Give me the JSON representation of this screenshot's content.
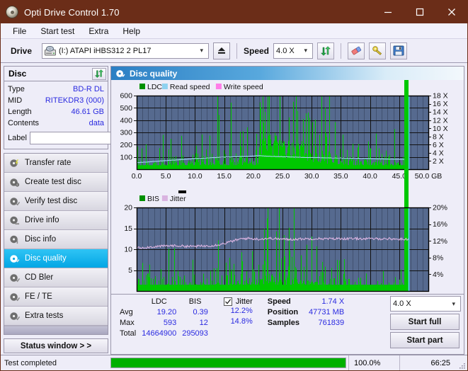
{
  "window": {
    "title": "Opti Drive Control 1.70",
    "icon": "disc-icon",
    "minimize": "minimize-icon",
    "maximize": "maximize-icon",
    "close": "close-icon"
  },
  "menu": {
    "items": [
      "File",
      "Start test",
      "Extra",
      "Help"
    ]
  },
  "toolbar": {
    "drive_label": "Drive",
    "drive_value": "(I:)  ATAPI iHBS312  2 PL17",
    "eject_icon": "eject-icon",
    "speed_label": "Speed",
    "speed_value": "4.0 X",
    "refresh_icon": "refresh-icon",
    "erase_icon": "eraser-icon",
    "bookmark_icon": "tag-icon",
    "save_icon": "floppy-save-icon"
  },
  "disc": {
    "title": "Disc",
    "refresh_icon": "refresh-icon",
    "rows": [
      {
        "key": "Type",
        "value": "BD-R DL"
      },
      {
        "key": "MID",
        "value": "RITEKDR3 (000)"
      },
      {
        "key": "Length",
        "value": "46.61 GB"
      },
      {
        "key": "Contents",
        "value": "data"
      }
    ],
    "label_key": "Label",
    "label_value": "",
    "label_placeholder": "",
    "label_button_icon": "disc-icon"
  },
  "sidebar": {
    "items": [
      {
        "label": "Transfer rate",
        "icon": "disc-transfer-icon",
        "active": false
      },
      {
        "label": "Create test disc",
        "icon": "disc-create-icon",
        "active": false
      },
      {
        "label": "Verify test disc",
        "icon": "disc-verify-icon",
        "active": false
      },
      {
        "label": "Drive info",
        "icon": "disc-drive-icon",
        "active": false
      },
      {
        "label": "Disc info",
        "icon": "disc-info-icon",
        "active": false
      },
      {
        "label": "Disc quality",
        "icon": "disc-quality-icon",
        "active": true
      },
      {
        "label": "CD Bler",
        "icon": "disc-bler-icon",
        "active": false
      },
      {
        "label": "FE / TE",
        "icon": "disc-fete-icon",
        "active": false
      },
      {
        "label": "Extra tests",
        "icon": "disc-extra-icon",
        "active": false
      }
    ],
    "status_window_button": "Status window > >"
  },
  "quality": {
    "header": "Disc quality",
    "header_icon": "disc-quality-icon"
  },
  "stats": {
    "columns": [
      "LDC",
      "BIS"
    ],
    "rows": [
      {
        "label": "Avg",
        "ldc": "19.20",
        "bis": "0.39",
        "jitter": "12.2%"
      },
      {
        "label": "Max",
        "ldc": "593",
        "bis": "12",
        "jitter": "14.8%"
      },
      {
        "label": "Total",
        "ldc": "14664900",
        "bis": "295093",
        "jitter": ""
      }
    ],
    "jitter_label": "Jitter",
    "jitter_checked": true,
    "speed_label": "Speed",
    "speed_value": "1.74 X",
    "position_label": "Position",
    "position_value": "47731 MB",
    "samples_label": "Samples",
    "samples_value": "761839",
    "speed_select": "4.0 X",
    "start_full": "Start full",
    "start_part": "Start part"
  },
  "statusbar": {
    "text": "Test completed",
    "progress_percent": 100,
    "percent_label": "100.0%",
    "elapsed": "66:25"
  },
  "colors": {
    "titlebar": "#6b2d18",
    "plot_bg": "#566a8f",
    "ldc_green": "#00c800",
    "bis_green": "#00c800",
    "read_speed": "#9fd8f2",
    "write_speed": "#ff7de8",
    "jitter": "#d9b3e0",
    "accent_blue": "#2a2ae0",
    "progress_green": "#00b000",
    "selection": "#03a6e4"
  },
  "chart_data": [
    {
      "type": "area",
      "title": "Disc quality - LDC / Read speed",
      "xlabel": "GB",
      "ylabel": "LDC",
      "xlim": [
        0,
        50
      ],
      "ylim": [
        0,
        600
      ],
      "y2lim": [
        0,
        18
      ],
      "y2label": "X",
      "xticks": [
        "0.0",
        "5.0",
        "10.0",
        "15.0",
        "20.0",
        "25.0",
        "30.0",
        "35.0",
        "40.0",
        "45.0",
        "50.0 GB"
      ],
      "yticks": [
        100,
        200,
        300,
        400,
        500,
        600
      ],
      "y2ticks": [
        "2 X",
        "4 X",
        "6 X",
        "8 X",
        "10 X",
        "12 X",
        "14 X",
        "16 X",
        "18 X"
      ],
      "grid": true,
      "legend": [
        {
          "name": "LDC",
          "color": "#009000"
        },
        {
          "name": "Read speed",
          "color": "#8fd2f0"
        },
        {
          "name": "Write speed",
          "color": "#ff7de8"
        }
      ],
      "data_end_gb": 46.61,
      "series": [
        {
          "name": "LDC",
          "color": "#00c800",
          "kind": "spikes",
          "x": [
            0.2,
            0.6,
            1.0,
            1.4,
            1.8,
            2.2,
            2.6,
            3.0,
            3.4,
            3.8,
            4.2,
            4.6,
            5.0,
            5.4,
            5.8,
            6.2,
            6.6,
            7.0,
            7.4,
            7.8,
            8.2,
            8.6,
            9.0,
            9.4,
            9.8,
            10.2,
            10.6,
            11.0,
            11.4,
            11.8,
            12.2,
            12.6,
            13.0,
            13.4,
            13.8,
            14.2,
            14.6,
            15.0,
            15.4,
            15.8,
            16.2,
            16.6,
            17.0,
            17.4,
            17.8,
            18.2,
            18.6,
            19.0,
            19.4,
            19.8,
            20.2,
            20.6,
            21.0,
            21.4,
            21.8,
            22.2,
            22.6,
            23.0,
            23.4,
            23.8,
            24.2,
            24.6,
            25.0,
            25.4,
            25.8,
            26.2,
            26.6,
            27.0,
            27.4,
            27.8,
            28.2,
            28.6,
            29.0,
            29.4,
            29.8,
            30.2,
            30.6,
            31.0,
            31.4,
            31.8,
            32.2,
            32.6,
            33.0,
            33.4,
            33.8,
            34.2,
            34.6,
            35.0,
            35.4,
            35.8,
            36.2,
            36.6,
            37.0,
            37.4,
            37.8,
            38.2,
            38.6,
            39.0,
            39.4,
            39.8,
            40.2,
            40.6,
            41.0,
            41.4,
            41.8,
            42.2,
            42.6,
            43.0,
            43.4,
            43.8,
            44.2,
            44.6,
            45.0,
            45.4,
            45.8,
            46.2,
            46.5
          ],
          "y": [
            60,
            45,
            80,
            55,
            120,
            70,
            50,
            160,
            90,
            65,
            110,
            75,
            55,
            140,
            85,
            60,
            195,
            100,
            70,
            125,
            80,
            55,
            215,
            95,
            70,
            150,
            85,
            60,
            175,
            105,
            75,
            130,
            90,
            65,
            260,
            110,
            80,
            145,
            95,
            70,
            190,
            115,
            85,
            210,
            125,
            90,
            240,
            130,
            95,
            175,
            110,
            80,
            320,
            430,
            380,
            470,
            520,
            440,
            590,
            480,
            410,
            540,
            460,
            380,
            500,
            430,
            350,
            470,
            390,
            320,
            430,
            350,
            280,
            390,
            310,
            250,
            330,
            270,
            210,
            290,
            230,
            180,
            250,
            200,
            160,
            220,
            175,
            140,
            195,
            155,
            125,
            175,
            140,
            115,
            160,
            130,
            105,
            145,
            120,
            100,
            135,
            110,
            92,
            125,
            105,
            88,
            118,
            98,
            82,
            112,
            95,
            80,
            105,
            90,
            78,
            100,
            85
          ]
        },
        {
          "name": "Read speed",
          "color": "#9fd8f2",
          "kind": "line",
          "axis": "right",
          "x": [
            0,
            2,
            4,
            6,
            8,
            10,
            12,
            14,
            16,
            18,
            20,
            21,
            22,
            24,
            26,
            28,
            30,
            32,
            34,
            36,
            38,
            40,
            42,
            44,
            46,
            46.6
          ],
          "y": [
            1.6,
            1.8,
            2.0,
            2.2,
            2.4,
            2.6,
            2.75,
            2.9,
            3.0,
            3.1,
            3.2,
            3.3,
            3.2,
            3.1,
            3.0,
            2.9,
            2.85,
            2.8,
            2.75,
            2.7,
            2.65,
            2.6,
            2.5,
            2.45,
            2.4,
            2.35
          ]
        }
      ]
    },
    {
      "type": "area",
      "title": "Disc quality - BIS / Jitter",
      "xlabel": "GB",
      "ylabel": "BIS",
      "xlim": [
        0,
        50
      ],
      "ylim": [
        0,
        20
      ],
      "y2lim": [
        0,
        20
      ],
      "y2label": "%",
      "xticks": [
        "0.0",
        "5.0",
        "10.0",
        "15.0",
        "20.0",
        "25.0",
        "30.0",
        "35.0",
        "40.0",
        "45.0",
        "50.0 GB"
      ],
      "yticks": [
        5,
        10,
        15,
        20
      ],
      "y2ticks": [
        "4%",
        "8%",
        "12%",
        "16%",
        "20%"
      ],
      "grid": true,
      "legend": [
        {
          "name": "BIS",
          "color": "#009000"
        },
        {
          "name": "Jitter",
          "color": "#d9b3e0"
        }
      ],
      "data_end_gb": 46.61,
      "series": [
        {
          "name": "BIS",
          "color": "#00c800",
          "kind": "spikes",
          "x": [
            0.2,
            0.6,
            1.0,
            1.4,
            1.8,
            2.2,
            2.6,
            3.0,
            3.4,
            3.8,
            4.2,
            4.6,
            5.0,
            5.4,
            5.8,
            6.2,
            6.6,
            7.0,
            7.4,
            7.8,
            8.2,
            8.6,
            9.0,
            9.4,
            9.8,
            10.2,
            10.6,
            11.0,
            11.4,
            11.8,
            12.2,
            12.6,
            13.0,
            13.4,
            13.8,
            14.2,
            14.6,
            15.0,
            15.4,
            15.8,
            16.2,
            16.6,
            17.0,
            17.4,
            17.8,
            18.2,
            18.6,
            19.0,
            19.4,
            19.8,
            20.2,
            20.6,
            21.0,
            21.4,
            21.8,
            22.2,
            22.6,
            23.0,
            23.4,
            23.8,
            24.2,
            24.6,
            25.0,
            25.4,
            25.8,
            26.2,
            26.6,
            27.0,
            27.4,
            27.8,
            28.2,
            28.6,
            29.0,
            29.4,
            29.8,
            30.2,
            30.6,
            31.0,
            31.4,
            31.8,
            32.2,
            32.6,
            33.0,
            33.4,
            33.8,
            34.2,
            34.6,
            35.0,
            35.4,
            35.8,
            36.2,
            36.6,
            37.0,
            37.4,
            37.8,
            38.2,
            38.6,
            39.0,
            39.4,
            39.8,
            40.2,
            40.6,
            41.0,
            41.4,
            41.8,
            42.2,
            42.6,
            43.0,
            43.4,
            43.8,
            44.2,
            44.6,
            45.0,
            45.4,
            45.8,
            46.2,
            46.5
          ],
          "y": [
            2.2,
            1.6,
            2.6,
            1.8,
            3.2,
            2.0,
            1.7,
            3.6,
            2.4,
            1.9,
            3.0,
            2.1,
            1.8,
            3.4,
            2.3,
            1.9,
            4.2,
            2.6,
            2.0,
            3.1,
            2.2,
            1.8,
            4.6,
            2.5,
            2.0,
            3.5,
            2.3,
            1.9,
            4.0,
            2.7,
            2.1,
            3.2,
            2.4,
            2.0,
            5.6,
            2.8,
            2.2,
            3.4,
            2.5,
            2.1,
            4.4,
            2.9,
            2.3,
            4.8,
            3.0,
            2.4,
            5.2,
            3.1,
            2.5,
            4.0,
            2.8,
            2.2,
            5.0,
            6.2,
            5.4,
            6.6,
            7.8,
            6.0,
            8.0,
            6.4,
            5.6,
            7.2,
            6.0,
            5.2,
            6.8,
            5.8,
            4.8,
            6.2,
            5.2,
            4.4,
            5.6,
            4.8,
            3.8,
            5.0,
            4.2,
            3.4,
            4.4,
            3.6,
            2.9,
            4.0,
            3.2,
            2.5,
            3.4,
            2.8,
            2.3,
            3.0,
            2.5,
            2.1,
            2.7,
            2.3,
            1.9,
            2.6,
            2.2,
            1.8,
            2.4,
            2.0,
            1.7,
            2.3,
            1.9,
            1.6,
            2.2,
            1.8,
            1.5,
            2.1,
            1.8,
            1.5,
            2.0,
            1.7,
            1.4,
            1.9,
            1.6,
            1.4,
            1.8,
            1.5,
            1.3
          ]
        },
        {
          "name": "Jitter",
          "color": "#d9b3e0",
          "kind": "line",
          "axis": "right",
          "x": [
            0,
            1,
            2,
            3,
            4,
            5,
            6,
            7,
            8,
            9,
            10,
            11,
            12,
            13,
            14,
            15,
            16,
            17,
            18,
            19,
            20,
            21,
            22,
            23,
            24,
            25,
            26,
            27,
            28,
            29,
            30,
            31,
            32,
            33,
            34,
            35,
            36,
            37,
            38,
            39,
            40,
            41,
            42,
            43,
            44,
            45,
            46,
            46.6
          ],
          "y": [
            10.3,
            10.4,
            10.5,
            10.6,
            10.7,
            10.8,
            10.85,
            10.8,
            10.75,
            10.7,
            10.7,
            10.75,
            10.8,
            10.9,
            11.1,
            11.4,
            11.8,
            12.2,
            12.5,
            12.6,
            12.5,
            12.4,
            12.55,
            12.6,
            12.5,
            12.4,
            12.35,
            12.4,
            12.45,
            12.5,
            12.5,
            12.55,
            12.5,
            12.5,
            12.5,
            12.55,
            12.5,
            12.5,
            12.55,
            12.5,
            12.5,
            12.5,
            12.5,
            12.5,
            12.45,
            12.4,
            12.4,
            12.4
          ]
        }
      ]
    }
  ]
}
